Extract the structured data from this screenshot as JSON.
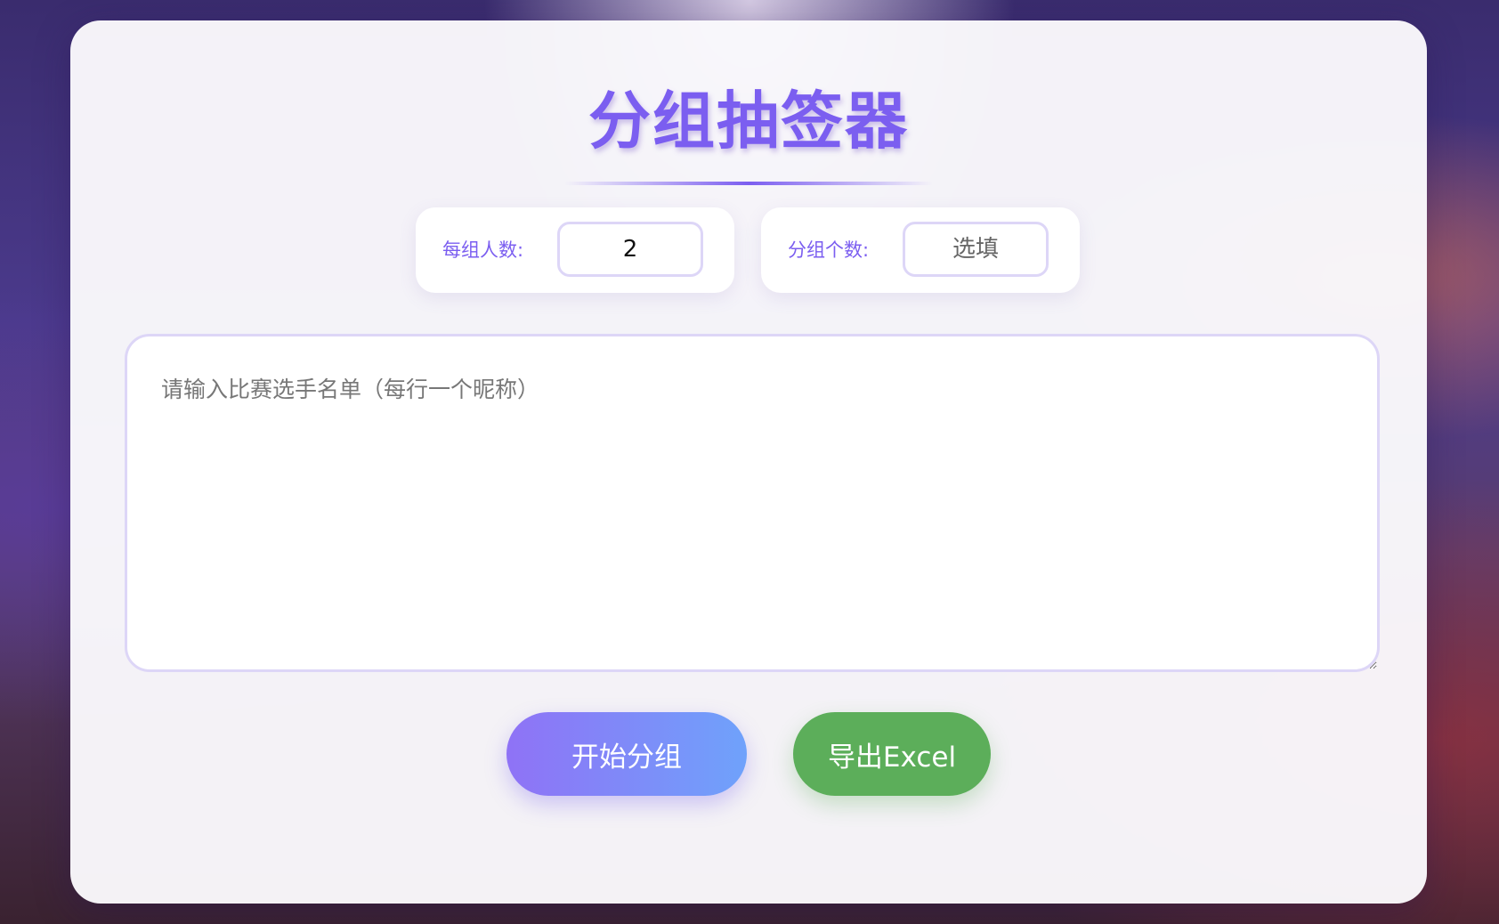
{
  "app": {
    "title": "分组抽签器"
  },
  "options": {
    "group_size": {
      "label": "每组人数:",
      "value": "2"
    },
    "group_count": {
      "label": "分组个数:",
      "placeholder": "选填",
      "value": ""
    }
  },
  "names": {
    "placeholder": "请输入比赛选手名单（每行一个昵称）",
    "value": ""
  },
  "actions": {
    "start_label": "开始分组",
    "export_label": "导出Excel"
  },
  "colors": {
    "accent": "#7b5ef0",
    "input_border": "#ddd6f7",
    "start_gradient_from": "#8f72f6",
    "start_gradient_to": "#6fa2fb",
    "export": "#5cae5a"
  }
}
